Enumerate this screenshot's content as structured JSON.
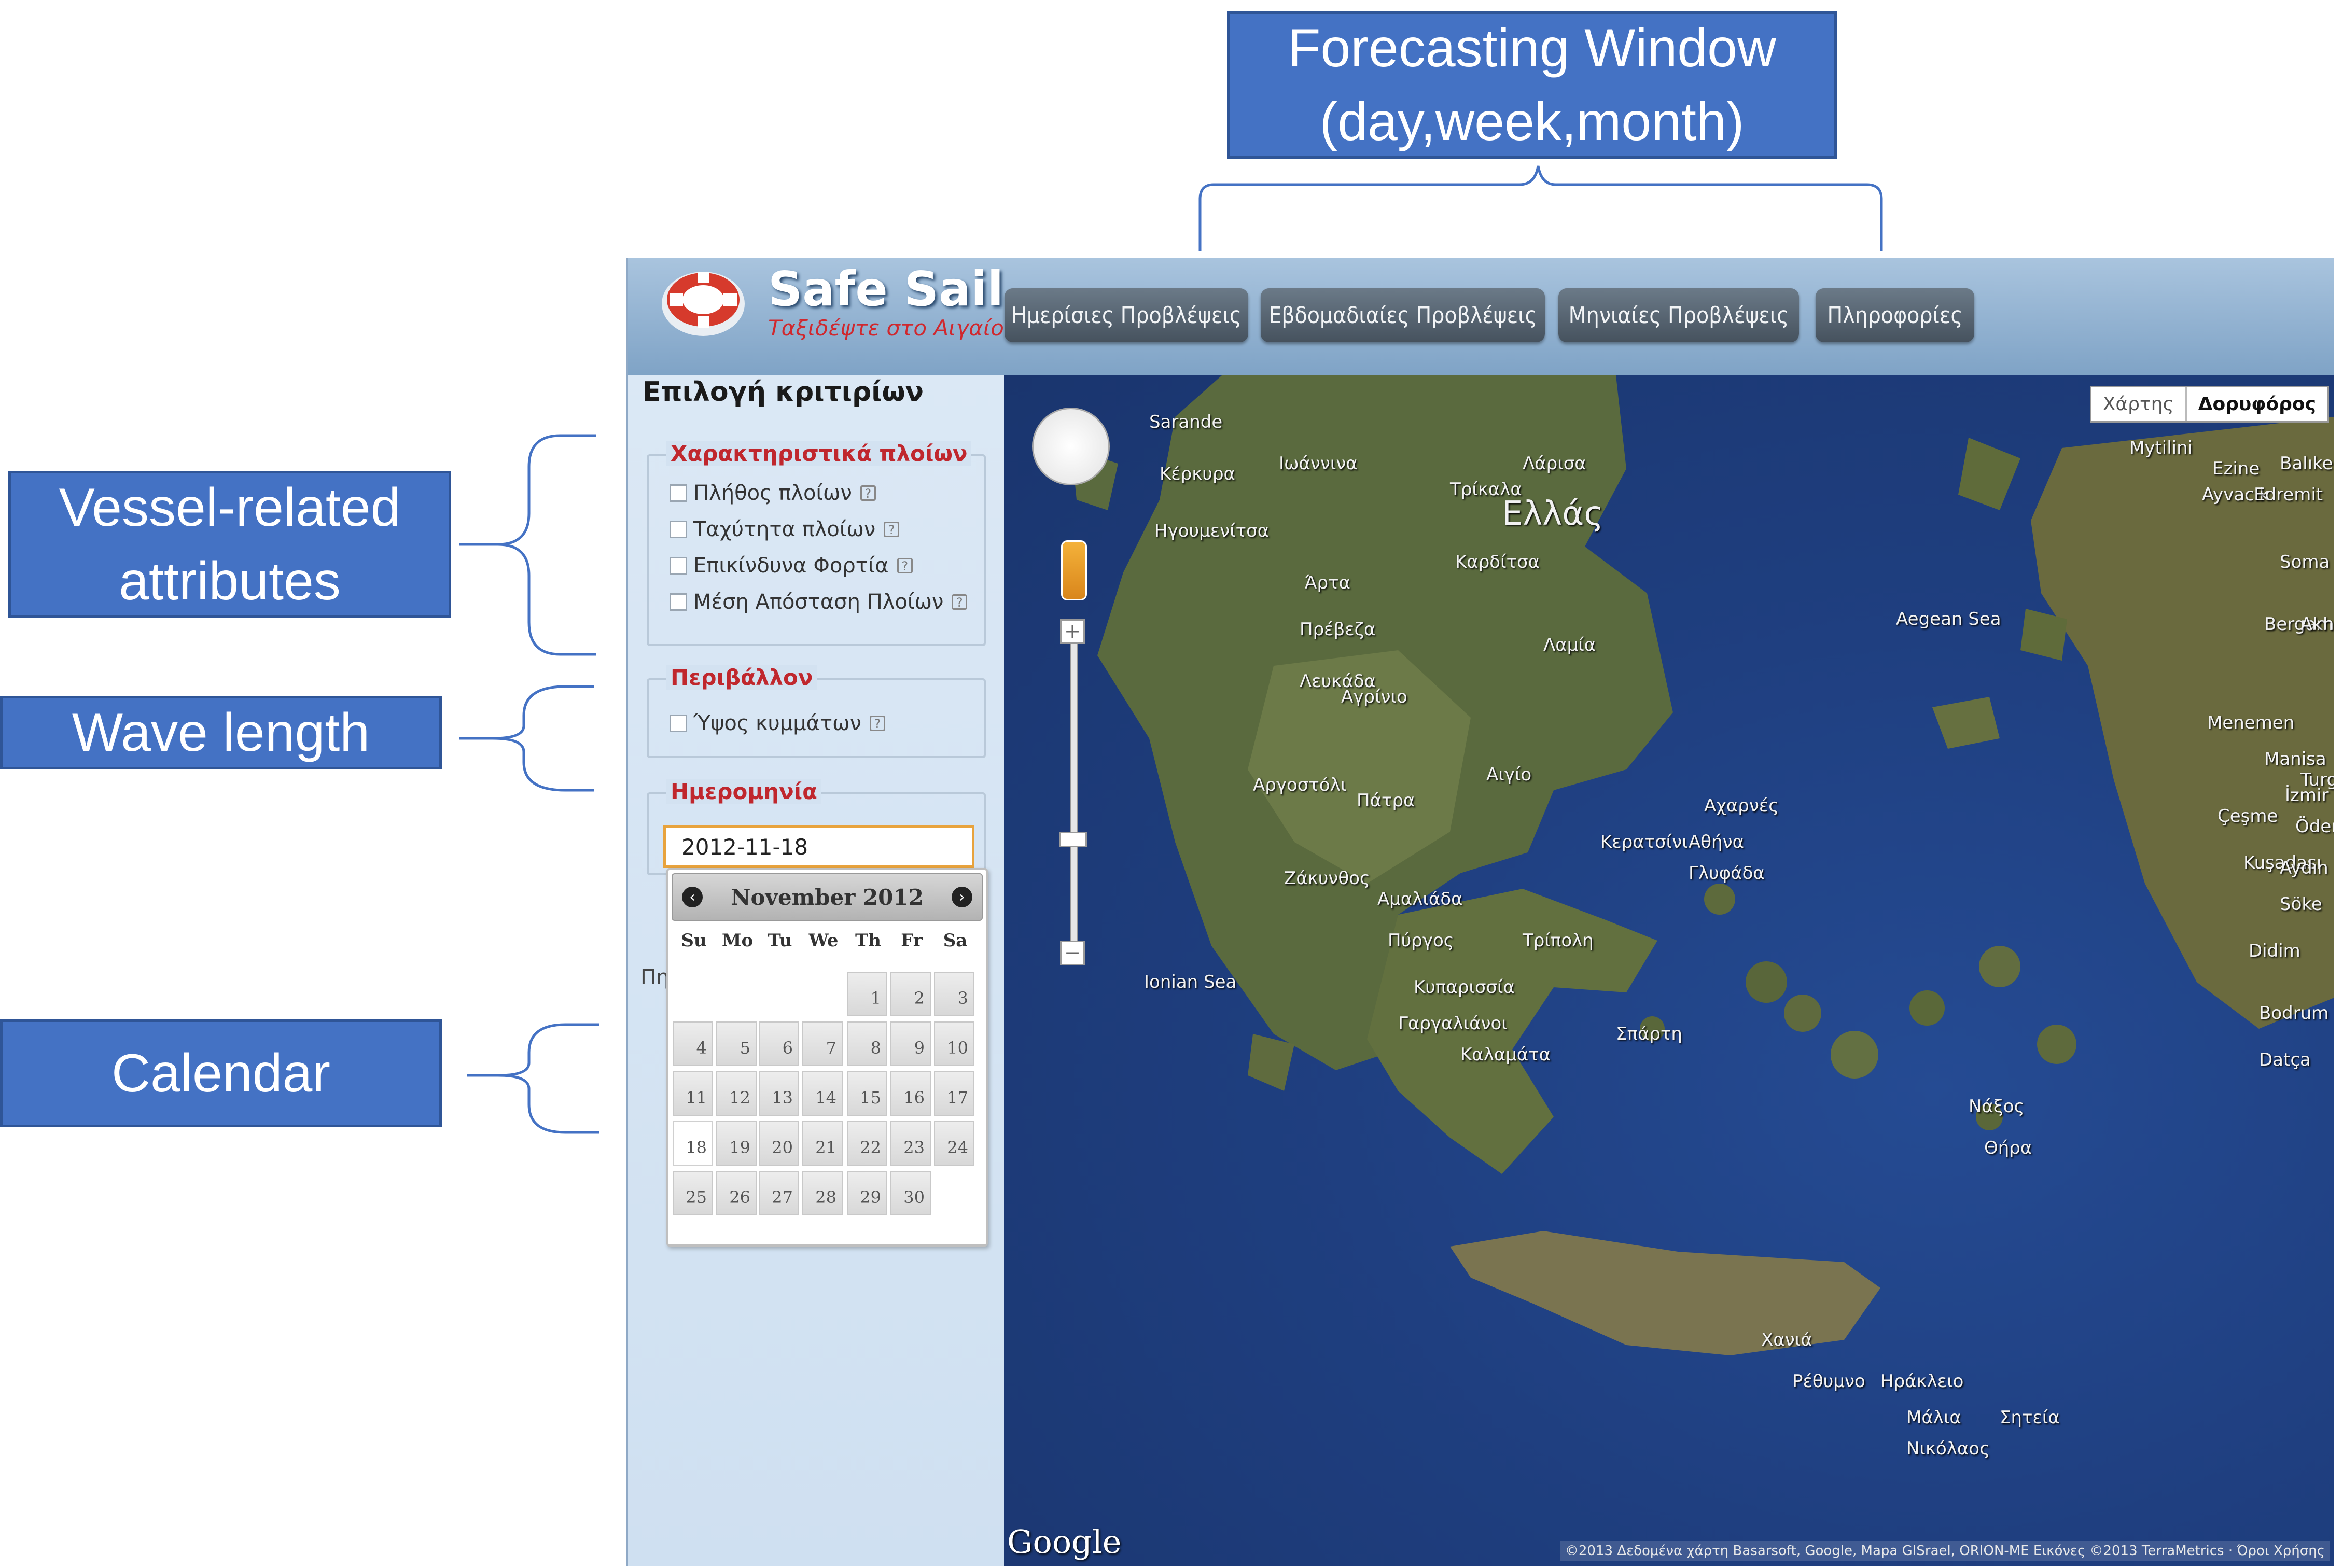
{
  "annotations": {
    "forecasting_window": "Forecasting Window\n(day,week,month)",
    "vessel_attributes": "Vessel-related\nattributes",
    "wave_length": "Wave length",
    "calendar": "Calendar"
  },
  "app": {
    "logo_title": "Safe Sail",
    "logo_subtitle": "Ταξιδέψτε στο Αιγαίο",
    "nav": [
      {
        "label": "Ημερίσιες Προβλέψεις"
      },
      {
        "label": "Εβδομαδιαίες Προβλέψεις"
      },
      {
        "label": "Μηνιαίες Προβλέψεις"
      },
      {
        "label": "Πληροφορίες"
      }
    ]
  },
  "sidebar": {
    "title": "Επιλογή κριτιρίων",
    "vessel_group": {
      "legend": "Χαρακτηριστικά πλοίων",
      "items": [
        "Πλήθος πλοίων",
        "Ταχύτητα πλοίων",
        "Επικίνδυνα Φορτία",
        "Μέση Απόσταση Πλοίων"
      ]
    },
    "environment_group": {
      "legend": "Περιβάλλον",
      "items": [
        "Ύψος κυμμάτων"
      ]
    },
    "date_group": {
      "legend": "Ημερομηνία",
      "value": "2012-11-18"
    },
    "stray_text": "Πη",
    "help_glyph": "?"
  },
  "calendar": {
    "month_label": "November 2012",
    "prev_arrow": "‹",
    "next_arrow": "›",
    "weekdays": [
      "Su",
      "Mo",
      "Tu",
      "We",
      "Th",
      "Fr",
      "Sa"
    ],
    "first_weekday_index": 4,
    "days_in_month": 30,
    "selected_day": 18
  },
  "map": {
    "type_map_label": "Χάρτης",
    "type_satellite_label": "Δορυφόρος",
    "zoom_in": "+",
    "zoom_out": "−",
    "google_logo": "Google",
    "copyright": "©2013 Δεδομένα χάρτη Basarsoft, Google, Mapa GISrael, ORION-ME Εικόνες ©2013 TerraMetrics · Όροι Χρήσης",
    "country_label": "Ελλάς",
    "places": [
      "Sarande",
      "Ιωάννινα",
      "Λάρισα",
      "Κέρκυρα",
      "Τρίκαλα",
      "Ηγουμενίτσα",
      "Καρδίτσα",
      "Άρτα",
      "Πρέβεζα",
      "Λαμία",
      "Λευκάδα",
      "Αγρίνιο",
      "Αιγίο",
      "Αργοστόλι",
      "Πάτρα",
      "Αχαρνές",
      "Κερατσίνι",
      "Αθήνα",
      "Γλυφάδα",
      "Ζάκυνθος",
      "Αμαλιάδα",
      "Πύργος",
      "Τρίπολη",
      "Καλαμάτα",
      "Κυπαρισσία",
      "Γαργαλιάνοι",
      "Σπάρτη",
      "Χανιά",
      "Ρέθυμνο",
      "Ηράκλειο",
      "Μάλια",
      "Σητεία",
      "Νικόλαος",
      "Νάξος",
      "Θήρα",
      "Mytilini",
      "Ezine",
      "Ayvacık",
      "Edremit",
      "Balıkesir",
      "Soma",
      "Bergama",
      "Akhisar",
      "Menemen",
      "Manisa",
      "İzmir",
      "Çeşme",
      "Kuşadası",
      "Söke",
      "Didim",
      "Bodrum",
      "Datça",
      "Aegean Sea",
      "Ionian Sea",
      "Turgutlu",
      "Ödemiş",
      "Aydın"
    ]
  }
}
